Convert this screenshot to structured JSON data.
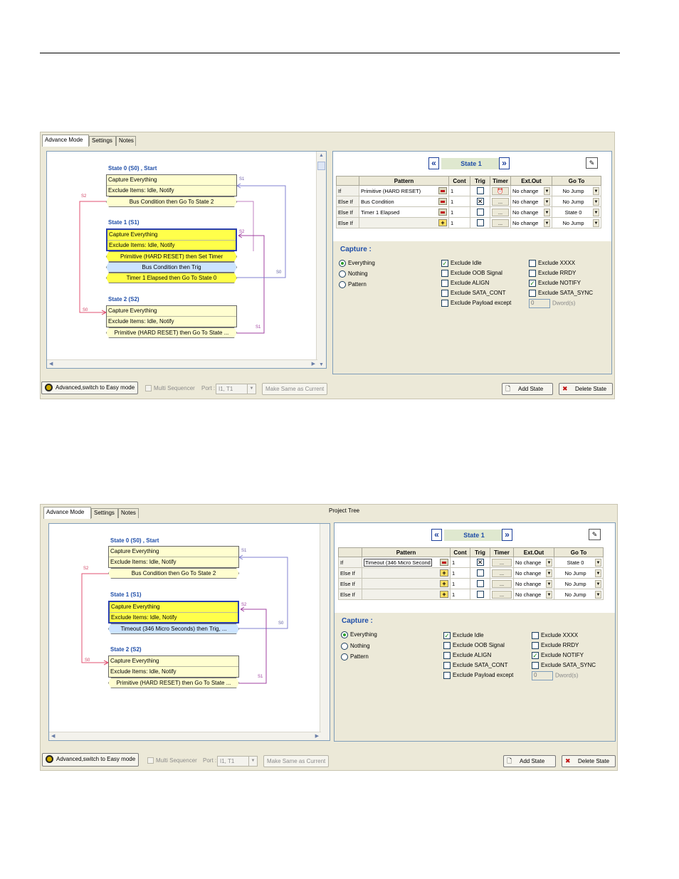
{
  "tabs": [
    "Advance Mode",
    "Settings",
    "Notes"
  ],
  "project_tree_label": "Project Tree",
  "diagram": {
    "s0": {
      "title": "State 0 (S0) , Start",
      "line1": "Capture Everything",
      "line2": "Exclude Items: Idle, Notify",
      "cond": "Bus Condition then Go To State 2"
    },
    "s1": {
      "title": "State 1 (S1)",
      "line1": "Capture Everything",
      "line2": "Exclude Items: Idle, Notify",
      "conds_a": [
        "Primitive (HARD RESET) then Set Timer",
        "Bus Condition then Trig",
        "Timer 1 Elapsed then Go To State 0"
      ],
      "cond_b": "Timeout (346 Micro Seconds) then Trig, ..."
    },
    "s2": {
      "title": "State 2 (S2)",
      "line1": "Capture Everything",
      "line2": "Exclude Items: Idle, Notify",
      "cond": "Primitive (HARD RESET) then Go To State ..."
    },
    "labels": {
      "s0": "S0",
      "s1": "S1",
      "s2": "S2"
    }
  },
  "editor": {
    "prev": "«",
    "next": "»",
    "state_label": "State 1",
    "columns": [
      "Pattern",
      "Cont",
      "Trig",
      "Timer",
      "Ext.Out",
      "Go To"
    ],
    "ellipsis": "...",
    "rows_a": [
      {
        "type": "If",
        "pattern": "Primitive (HARD RESET)",
        "cont": "1",
        "trig": "",
        "timer": "⏰",
        "ext": "No change",
        "goto": "No Jump"
      },
      {
        "type": "Else If",
        "pattern": "Bus Condition",
        "cont": "1",
        "trig": "✕",
        "timer": "...",
        "ext": "No change",
        "goto": "No Jump"
      },
      {
        "type": "Else If",
        "pattern": "Timer 1 Elapsed",
        "cont": "1",
        "trig": "",
        "timer": "...",
        "ext": "No change",
        "goto": "State 0"
      },
      {
        "type": "Else If",
        "pattern": "",
        "cont": "1",
        "trig": "",
        "timer": "...",
        "ext": "No change",
        "goto": "No Jump"
      }
    ],
    "rows_b": [
      {
        "type": "If",
        "pattern": "Timeout (346 Micro Second",
        "cont": "1",
        "trig": "✕",
        "timer": "...",
        "ext": "No change",
        "goto": "State 0"
      },
      {
        "type": "Else If",
        "pattern": "",
        "cont": "1",
        "trig": "",
        "timer": "...",
        "ext": "No change",
        "goto": "No Jump"
      },
      {
        "type": "Else If",
        "pattern": "",
        "cont": "1",
        "trig": "",
        "timer": "...",
        "ext": "No change",
        "goto": "No Jump"
      },
      {
        "type": "Else If",
        "pattern": "",
        "cont": "1",
        "trig": "",
        "timer": "...",
        "ext": "No change",
        "goto": "No Jump"
      }
    ],
    "capture_title": "Capture :",
    "radios": [
      "Everything",
      "Nothing",
      "Pattern"
    ],
    "checks_left": [
      "Exclude Idle",
      "Exclude OOB Signal",
      "Exclude ALIGN",
      "Exclude SATA_CONT",
      "Exclude Payload except"
    ],
    "checks_right": [
      "Exclude XXXX",
      "Exclude RRDY",
      "Exclude NOTIFY",
      "Exclude SATA_SYNC"
    ],
    "dword_value": "0",
    "dword_label": "Dword(s)"
  },
  "bottom": {
    "easy_mode": "Advanced,switch to Easy mode",
    "multi_seq": "Multi Sequencer",
    "port_label": "Port :",
    "port_value": "I1, T1",
    "make_same": "Make Same as Current",
    "add_state": "Add State",
    "delete_state": "Delete State"
  }
}
